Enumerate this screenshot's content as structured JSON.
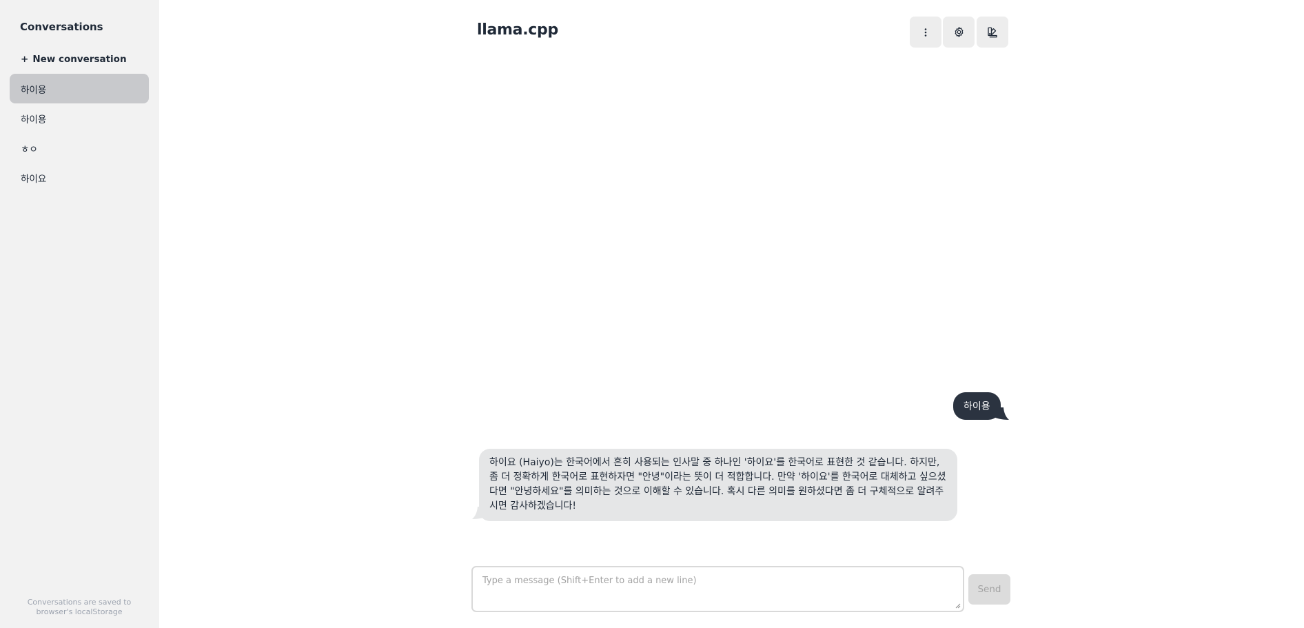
{
  "sidebar": {
    "title": "Conversations",
    "new_conversation_label": "New conversation",
    "new_conversation_plus": "+",
    "items": [
      {
        "label": "하이용",
        "active": true
      },
      {
        "label": "하이용",
        "active": false
      },
      {
        "label": "ㅎㅇ",
        "active": false
      },
      {
        "label": "하이요",
        "active": false
      }
    ],
    "footer_line1": "Conversations are saved to",
    "footer_line2": "browser's localStorage"
  },
  "header": {
    "title": "llama.cpp",
    "buttons": [
      {
        "icon": "more-vertical-icon"
      },
      {
        "icon": "gear-icon"
      },
      {
        "icon": "theme-palette-icon"
      }
    ]
  },
  "messages": [
    {
      "role": "user",
      "text": "하이용"
    },
    {
      "role": "assistant",
      "text": "하이요 (Haiyo)는 한국어에서 흔히 사용되는 인사말 중 하나인 '하이요'를 한국어로 표현한 것 같습니다. 하지만, 좀 더 정확하게 한국어로 표현하자면 \"안녕\"이라는 뜻이 더 적합합니다. 만약 '하이요'를 한국어로 대체하고 싶으셨다면 \"안녕하세요\"를 의미하는 것으로 이해할 수 있습니다. 혹시 다른 의미를 원하셨다면 좀 더 구체적으로 알려주시면 감사하겠습니다!"
    }
  ],
  "composer": {
    "placeholder": "Type a message (Shift+Enter to add a new line)",
    "value": "",
    "send_label": "Send"
  },
  "colors": {
    "sidebar_bg": "#f2f2f2",
    "active_item_bg": "#c8c9cc",
    "user_bubble": "#2b3340",
    "assistant_bubble": "#e5e6e7",
    "header_button_bg": "#ededed"
  }
}
